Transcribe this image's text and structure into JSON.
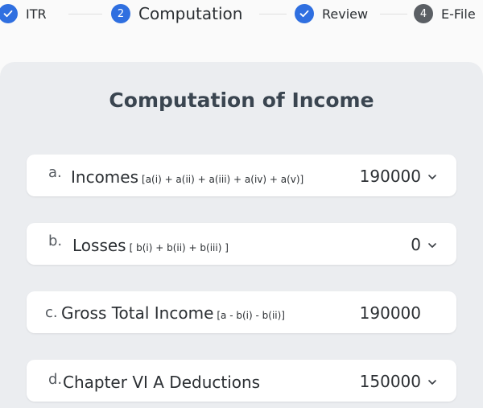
{
  "stepper": {
    "steps": [
      {
        "label": "ITR",
        "marker": "check-icon"
      },
      {
        "label": "Computation",
        "marker": "2"
      },
      {
        "label": "Review",
        "marker": "check-icon"
      },
      {
        "label": "E-File",
        "marker": "4"
      }
    ]
  },
  "colors": {
    "accent": "#2f6fe0",
    "inactive": "#5b5f64",
    "panel": "#ebedf0",
    "card": "#ffffff"
  },
  "section": {
    "title": "Computation of Income",
    "rows": [
      {
        "letter": "a.",
        "label": "Incomes",
        "sub": "[a(i) + a(ii) + a(iii) + a(iv) + a(v)]",
        "value": "190000",
        "expandable": true
      },
      {
        "letter": "b.",
        "label": "Losses",
        "sub": "[ b(i) + b(ii) + b(iii) ]",
        "value": "0",
        "expandable": true
      },
      {
        "letter": "c.",
        "label": "Gross Total Income",
        "sub": "[a - b(i) - b(ii)]",
        "value": "190000",
        "expandable": false
      },
      {
        "letter": "d.",
        "label": "Chapter VI A Deductions",
        "sub": "",
        "value": "150000",
        "expandable": true
      }
    ]
  }
}
